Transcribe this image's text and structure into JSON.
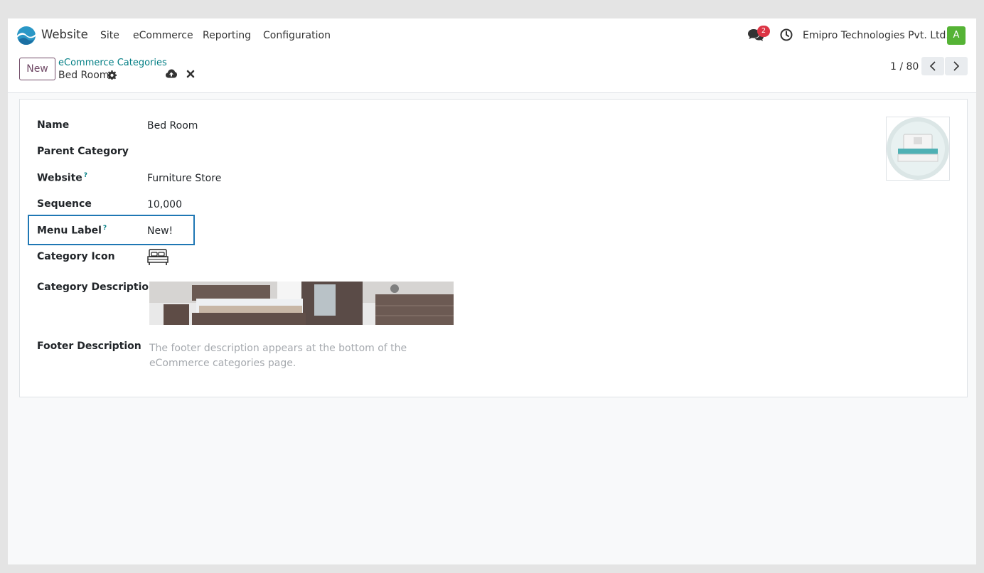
{
  "navbar": {
    "app_name": "Website",
    "menu": [
      "Site",
      "eCommerce",
      "Reporting",
      "Configuration"
    ],
    "chat_badge": "2",
    "company": "Emipro Technologies Pvt. Ltd.",
    "avatar_letter": "A",
    "accent_color": "#714b67",
    "avatar_color": "#55b335"
  },
  "control_panel": {
    "new_label": "New",
    "breadcrumb_parent": "eCommerce Categories",
    "breadcrumb_current": "Bed Room",
    "pager": "1 / 80"
  },
  "form": {
    "name_label": "Name",
    "name_value": "Bed Room",
    "parent_label": "Parent Category",
    "parent_value": "",
    "website_label": "Website",
    "website_value": "Furniture Store",
    "sequence_label": "Sequence",
    "sequence_value": "10,000",
    "menu_label_label": "Menu Label",
    "menu_label_value": "New!",
    "help_mark": "?",
    "category_icon_label": "Category Icon",
    "category_description_label": "Category Description",
    "footer_description_label": "Footer Description",
    "footer_description_placeholder": "The footer description appears at the bottom of the eCommerce categories page."
  }
}
